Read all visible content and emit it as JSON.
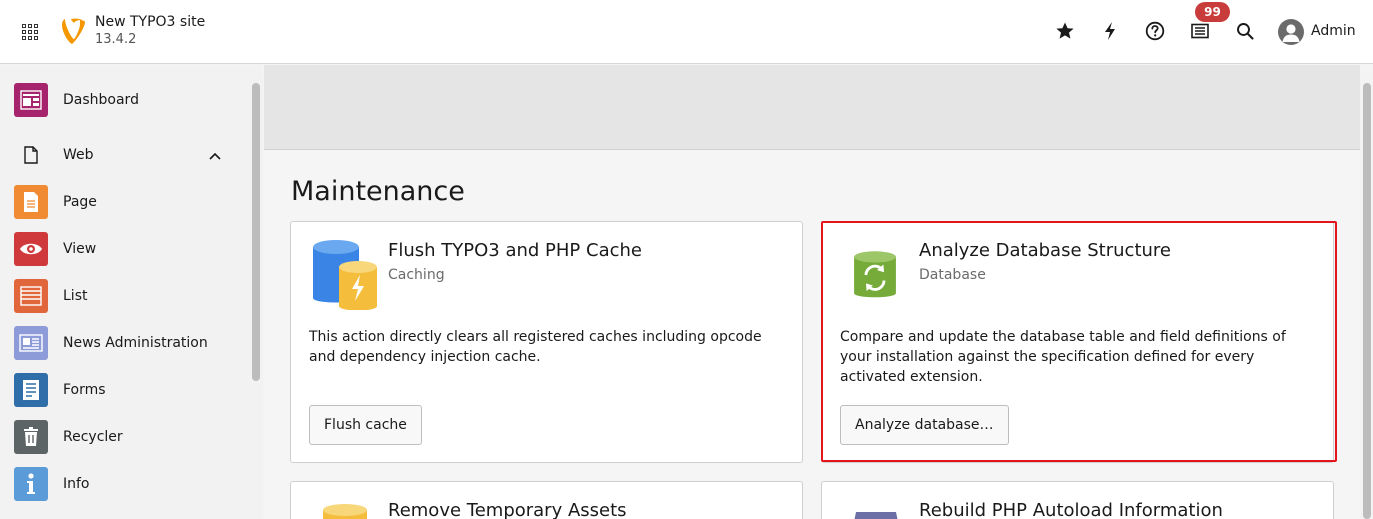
{
  "topbar": {
    "site_title": "New TYPO3 site",
    "site_version": "13.4.2",
    "notification_count": "99",
    "user_name": "Admin",
    "icons": [
      "app-grid-icon",
      "typo3-logo",
      "star-icon",
      "bolt-icon",
      "help-icon",
      "list-icon",
      "search-icon",
      "user-avatar-icon"
    ]
  },
  "sidebar": {
    "items": [
      {
        "label": "Dashboard",
        "icon": "dashboard-icon",
        "color": "#a6246b"
      },
      {
        "label": "Web",
        "icon": "page-outline-icon",
        "color": "none"
      },
      {
        "label": "Page",
        "icon": "page-icon",
        "color": "#f08a33"
      },
      {
        "label": "View",
        "icon": "eye-icon",
        "color": "#d0393b"
      },
      {
        "label": "List",
        "icon": "list-icon",
        "color": "#e2663b"
      },
      {
        "label": "News Administration",
        "icon": "news-icon",
        "color": "#8d9bd9"
      },
      {
        "label": "Forms",
        "icon": "forms-icon",
        "color": "#2f6ea8"
      },
      {
        "label": "Recycler",
        "icon": "trash-icon",
        "color": "#5d6466"
      },
      {
        "label": "Info",
        "icon": "info-icon",
        "color": "#5b9bd8"
      }
    ]
  },
  "main": {
    "title": "Maintenance",
    "cards": [
      {
        "title": "Flush TYPO3 and PHP Cache",
        "subtitle": "Caching",
        "text": "This action directly clears all registered caches including opcode and dependency injection cache.",
        "button": "Flush cache",
        "icon": "cache-database-icon"
      },
      {
        "title": "Analyze Database Structure",
        "subtitle": "Database",
        "text": "Compare and update the database table and field definitions of your installation against the specification defined for every activated extension.",
        "button": "Analyze database…",
        "icon": "database-sync-icon"
      },
      {
        "title": "Remove Temporary Assets",
        "icon": "assets-database-icon"
      },
      {
        "title": "Rebuild PHP Autoload Information",
        "icon": "autoload-icon"
      }
    ]
  },
  "colors": {
    "accent": "#f49700",
    "highlight": "#e3141b",
    "badge": "#c83c3c"
  }
}
